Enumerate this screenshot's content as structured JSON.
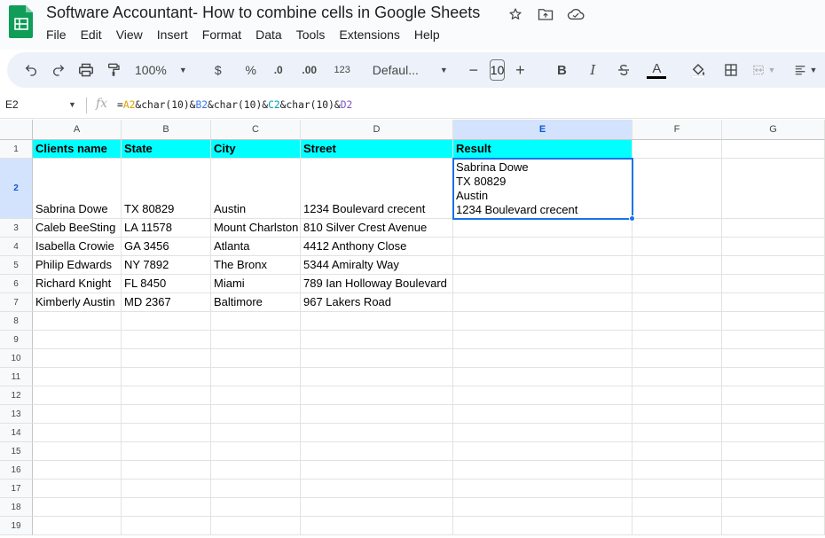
{
  "title": "Software Accountant- How to combine cells in Google Sheets",
  "menu": [
    "File",
    "Edit",
    "View",
    "Insert",
    "Format",
    "Data",
    "Tools",
    "Extensions",
    "Help"
  ],
  "toolbar": {
    "zoom": "100%",
    "currency": "$",
    "percent": "%",
    "dec_decrease": ".0",
    "dec_increase": ".00",
    "number_format": "123",
    "font": "Defaul...",
    "font_size": "10",
    "bold": "B",
    "italic": "I",
    "text_color_letter": "A",
    "text_color": "#000000"
  },
  "formula_bar": {
    "cell_ref": "E2",
    "fx": "fx",
    "formula_parts": [
      "=",
      "A2",
      "&char(10)&",
      "B2",
      "&char(10)&",
      "C2",
      "&char(10)&",
      "D2"
    ]
  },
  "columns": [
    "A",
    "B",
    "C",
    "D",
    "E",
    "F",
    "G"
  ],
  "selected_column": "E",
  "selected_row": "2",
  "header_color": "#00ffff",
  "rows": [
    {
      "num": "1",
      "cells": [
        "Clients name",
        "State",
        "City",
        "Street",
        "Result"
      ]
    },
    {
      "num": "2",
      "cells": [
        "Sabrina Dowe",
        "TX 80829",
        "Austin",
        "1234 Boulevard crecent",
        ""
      ]
    },
    {
      "num": "3",
      "cells": [
        "Caleb BeeSting",
        "LA 11578",
        "Mount Charlston",
        "810 Silver Crest Avenue",
        ""
      ]
    },
    {
      "num": "4",
      "cells": [
        "Isabella Crowie",
        "GA 3456",
        "Atlanta",
        "4412 Anthony Close",
        ""
      ]
    },
    {
      "num": "5",
      "cells": [
        "Philip Edwards",
        "NY 7892",
        "The Bronx",
        "5344 Amiralty Way",
        ""
      ]
    },
    {
      "num": "6",
      "cells": [
        "Richard Knight",
        "FL 8450",
        "Miami",
        "789 Ian Holloway Boulevard",
        ""
      ]
    },
    {
      "num": "7",
      "cells": [
        "Kimberly Austin",
        "MD 2367",
        "Baltimore",
        "967 Lakers Road",
        ""
      ]
    }
  ],
  "result_lines": [
    "Sabrina Dowe",
    "TX 80829",
    "Austin",
    "1234 Boulevard crecent"
  ],
  "empty_rows": [
    "8",
    "9",
    "10",
    "11",
    "12",
    "13",
    "14",
    "15",
    "16",
    "17",
    "18",
    "19"
  ]
}
